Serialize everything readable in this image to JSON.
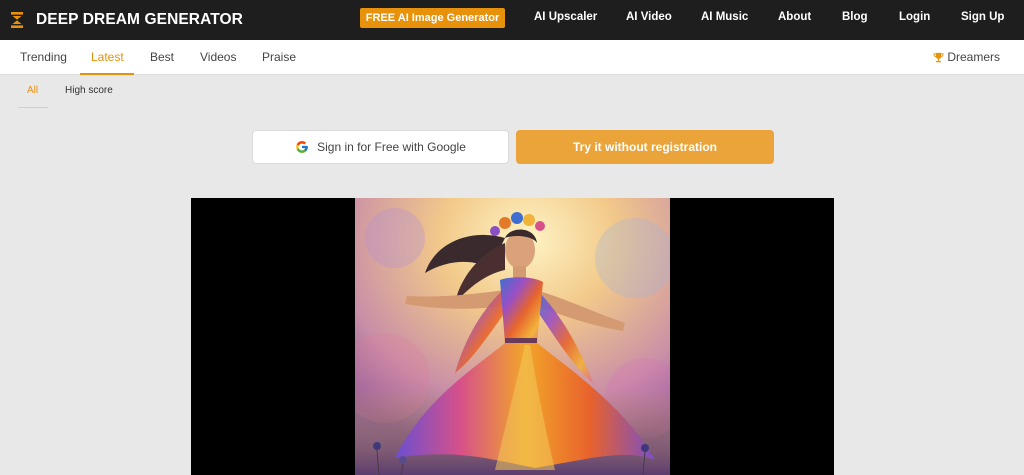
{
  "header": {
    "logo_text": "DEEP DREAM GENERATOR",
    "logo_icon": "hourglass-logo-icon",
    "cta_label": "FREE AI Image Generator",
    "nav": [
      "AI Upscaler",
      "AI Video",
      "AI Music",
      "About",
      "Blog",
      "Login",
      "Sign Up"
    ]
  },
  "tabs": [
    "Trending",
    "Latest",
    "Best",
    "Videos",
    "Praise"
  ],
  "active_tab": "Latest",
  "dreamers_label": "Dreamers",
  "filters": [
    "All",
    "High score"
  ],
  "active_filter": "All",
  "actions": {
    "google_label": "Sign in for Free with Google",
    "try_label": "Try it without registration"
  },
  "colors": {
    "accent": "#e8920c",
    "topbar": "#1e1e1e",
    "page_bg": "#e8e8e8",
    "try_button": "#eaa43a"
  }
}
